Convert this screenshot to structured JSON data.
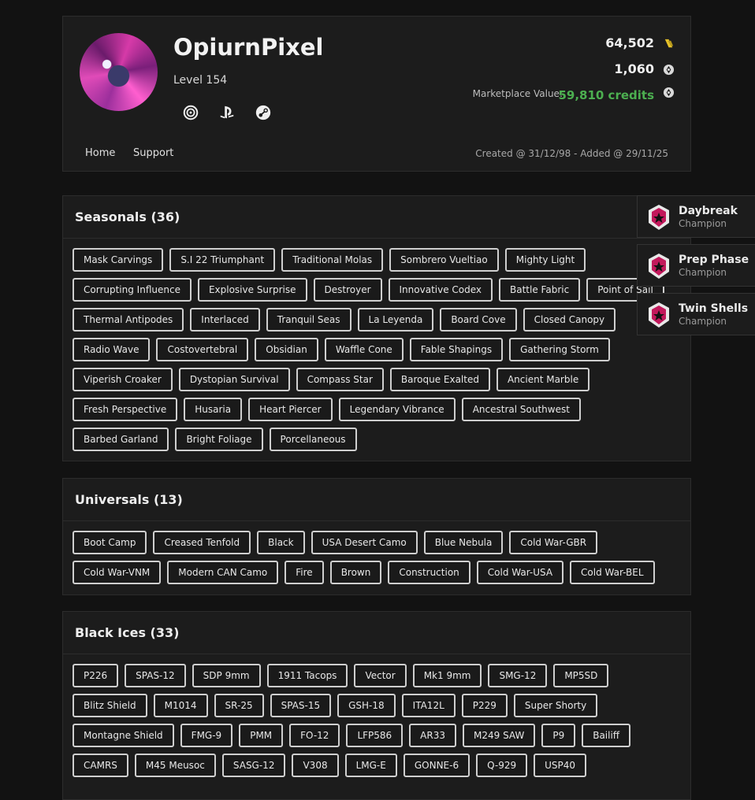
{
  "profile": {
    "username": "OpiurnPixel",
    "level": "Level 154",
    "platforms": [
      "ubisoft-icon",
      "playstation-icon",
      "steam-icon"
    ],
    "renown": "64,502",
    "credits": "1,060",
    "marketplace_label": "Marketplace Value:",
    "marketplace_value": "59,810 credits",
    "created": "Created @ 31/12/98 - Added @ 29/11/25",
    "colors": {
      "accent_green": "#4caf50",
      "renown_yellow": "#e6c229"
    }
  },
  "nav": {
    "home": "Home",
    "support": "Support"
  },
  "champions": [
    {
      "name": "Daybreak",
      "rank": "Champion"
    },
    {
      "name": "Prep Phase",
      "rank": "Champion"
    },
    {
      "name": "Twin Shells",
      "rank": "Champion"
    }
  ],
  "sections": {
    "seasonals": {
      "title": "Seasonals (36)",
      "items": [
        "Mask Carvings",
        "S.I 22 Triumphant",
        "Traditional Molas",
        "Sombrero Vueltiao",
        "Mighty Light",
        "Corrupting Influence",
        "Explosive Surprise",
        "Destroyer",
        "Innovative Codex",
        "Battle Fabric",
        "Point of Sail",
        "Thermal Antipodes",
        "Interlaced",
        "Tranquil Seas",
        "La Leyenda",
        "Board Cove",
        "Closed Canopy",
        "Radio Wave",
        "Costovertebral",
        "Obsidian",
        "Waffle Cone",
        "Fable Shapings",
        "Gathering Storm",
        "Viperish Croaker",
        "Dystopian Survival",
        "Compass Star",
        "Baroque Exalted",
        "Ancient Marble",
        "Fresh Perspective",
        "Husaria",
        "Heart Piercer",
        "Legendary Vibrance",
        "Ancestral Southwest",
        "Barbed Garland",
        "Bright Foliage",
        "Porcellaneous"
      ]
    },
    "universals": {
      "title": "Universals (13)",
      "items": [
        "Boot Camp",
        "Creased Tenfold",
        "Black",
        "USA Desert Camo",
        "Blue Nebula",
        "Cold War-GBR",
        "Cold War-VNM",
        "Modern CAN Camo",
        "Fire",
        "Brown",
        "Construction",
        "Cold War-USA",
        "Cold War-BEL"
      ]
    },
    "blackices": {
      "title": "Black Ices (33)",
      "items": [
        "P226",
        "SPAS-12",
        "SDP 9mm",
        "1911 Tacops",
        "Vector",
        "Mk1 9mm",
        "SMG-12",
        "MP5SD",
        "Blitz Shield",
        "M1014",
        "SR-25",
        "SPAS-15",
        "GSH-18",
        "ITA12L",
        "P229",
        "Super Shorty",
        "Montagne Shield",
        "FMG-9",
        "PMM",
        "FO-12",
        "LFP586",
        "AR33",
        "M249 SAW",
        "P9",
        "Bailiff",
        "CAMRS",
        "M45 Meusoc",
        "SASG-12",
        "V308",
        "LMG-E",
        "GONNE-6",
        "Q-929",
        "USP40"
      ]
    }
  }
}
